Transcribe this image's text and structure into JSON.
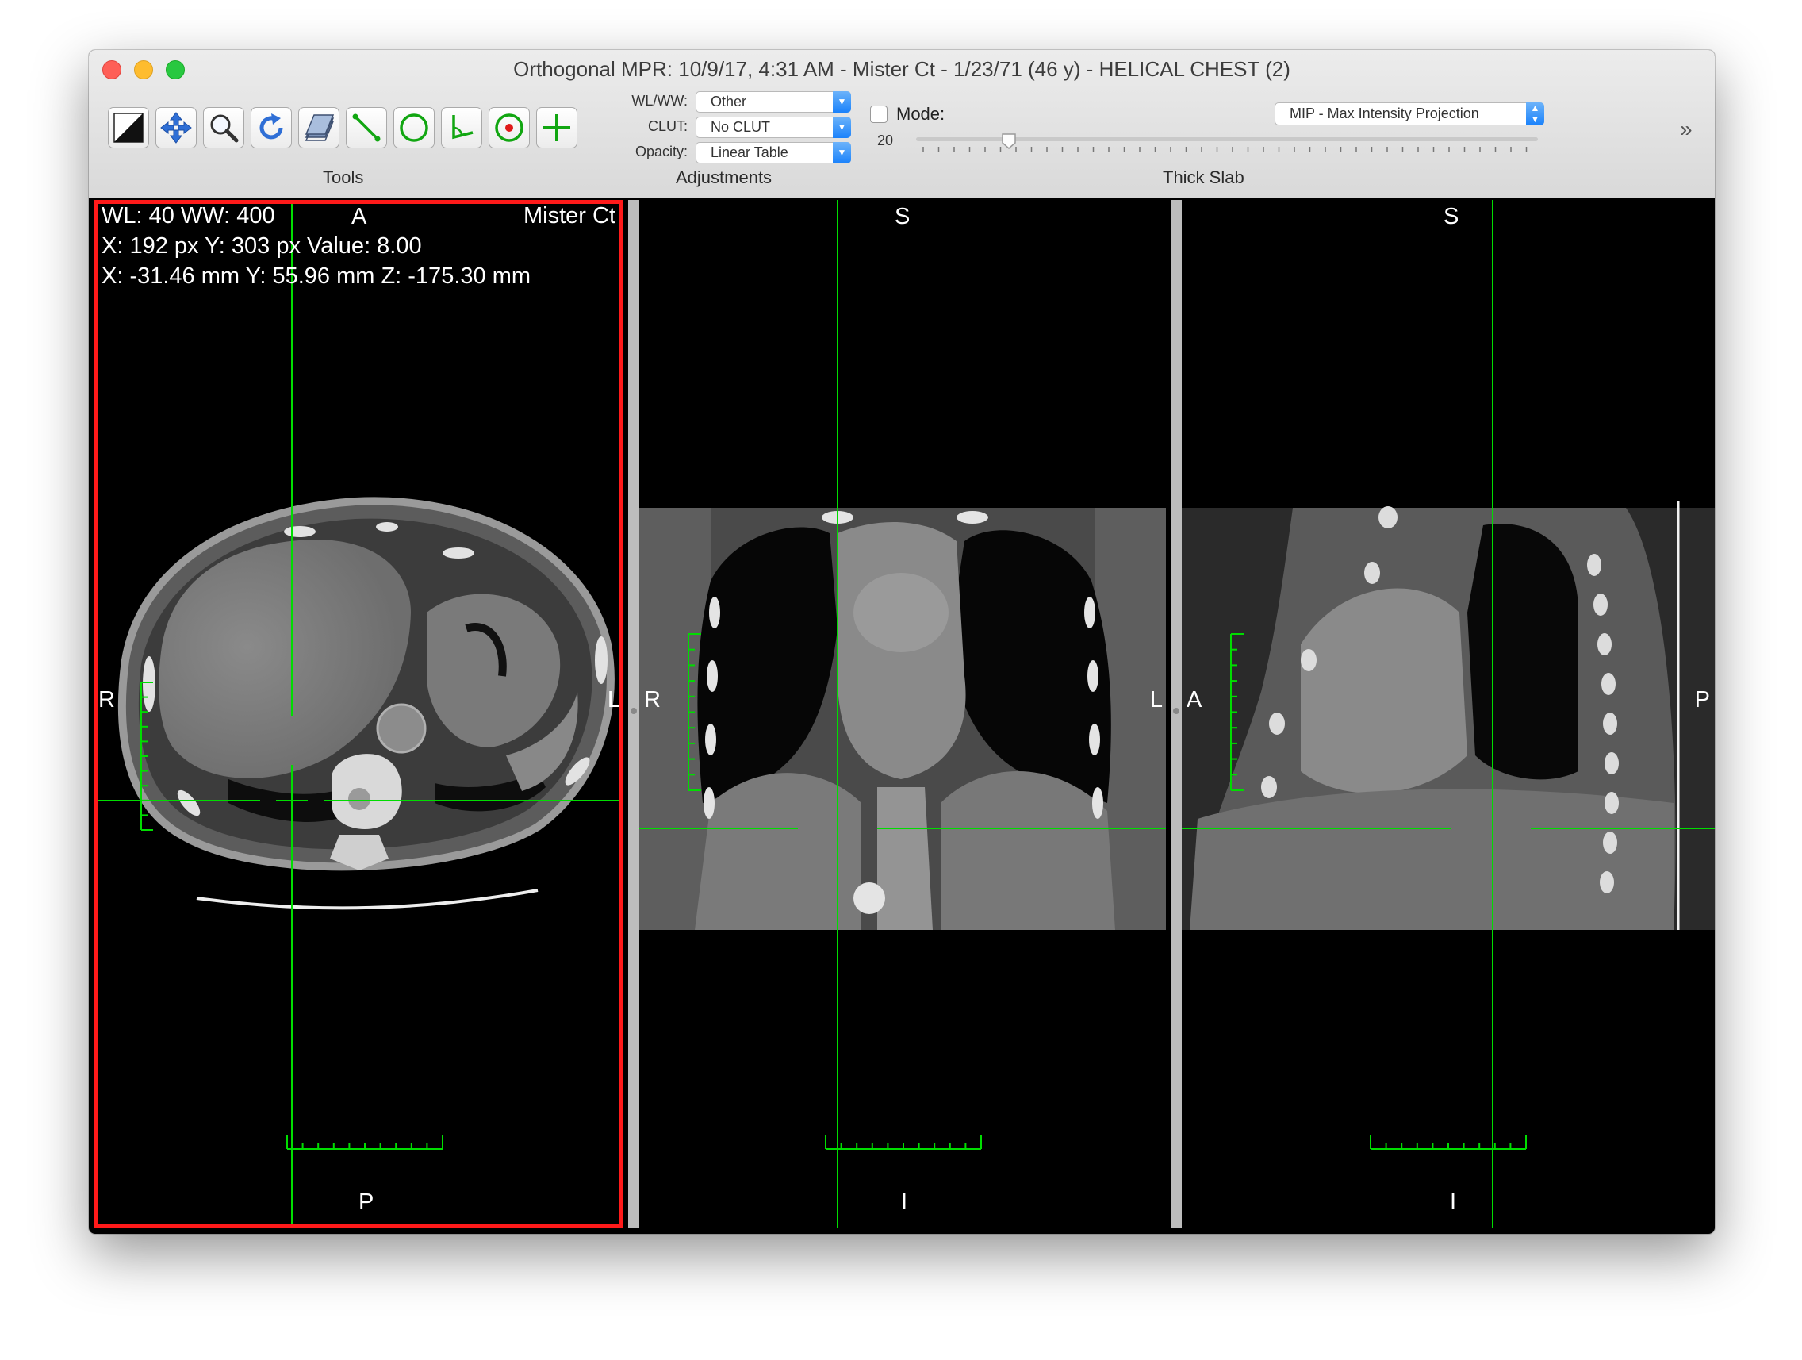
{
  "window": {
    "title": "Orthogonal MPR: 10/9/17, 4:31 AM - Mister Ct - 1/23/71 (46 y) - HELICAL CHEST (2)"
  },
  "toolbar": {
    "tools_label": "Tools",
    "adjustments_label": "Adjustments",
    "thick_slab_label": "Thick Slab",
    "tools": [
      {
        "name": "window-level-icon"
      },
      {
        "name": "move-icon"
      },
      {
        "name": "zoom-icon"
      },
      {
        "name": "rotate-icon"
      },
      {
        "name": "scroll-stack-icon"
      },
      {
        "name": "length-icon"
      },
      {
        "name": "oval-roi-icon"
      },
      {
        "name": "angle-icon"
      },
      {
        "name": "point-roi-icon"
      },
      {
        "name": "cross-icon"
      }
    ],
    "wlww_label": "WL/WW:",
    "wlww_value": "Other",
    "clut_label": "CLUT:",
    "clut_value": "No CLUT",
    "opacity_label": "Opacity:",
    "opacity_value": "Linear Table",
    "mode_label": "Mode:",
    "mode_checked": false,
    "mode_value": "MIP - Max Intensity Projection",
    "slab_thickness": "20",
    "more_glyph": "»"
  },
  "viewports": {
    "axial": {
      "wlww": "WL: 40 WW: 400",
      "top": "A",
      "patient": "Mister Ct",
      "pixel_info": "X: 192 px Y: 303 px Value: 8.00",
      "mm_info": "X: -31.46 mm Y: 55.96 mm Z: -175.30 mm",
      "left": "R",
      "right": "L",
      "bottom": "P",
      "selected": true
    },
    "coronal": {
      "top": "S",
      "left": "R",
      "right": "L",
      "bottom": "I"
    },
    "sagittal": {
      "top": "S",
      "left": "A",
      "right": "P",
      "bottom": "I"
    }
  },
  "colors": {
    "crosshair": "#00dd00",
    "selection_border": "#ff1a1a",
    "popup_accent": "#1a82fb"
  }
}
